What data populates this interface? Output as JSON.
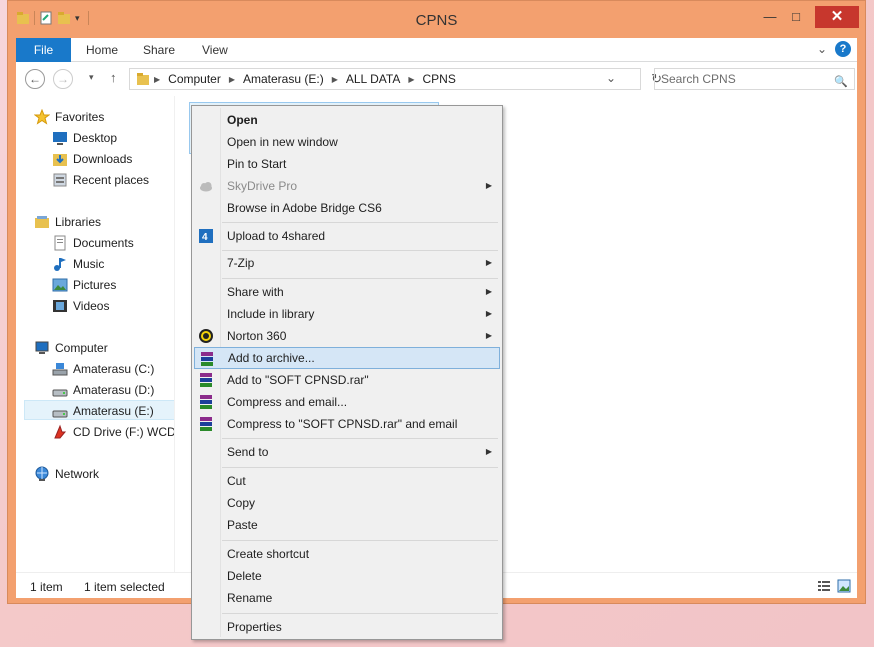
{
  "window": {
    "title": "CPNS",
    "min_label": "—",
    "max_label": "□",
    "close_label": "✕"
  },
  "ribbon": {
    "file_label": "File",
    "tabs": [
      "Home",
      "Share",
      "View"
    ],
    "expand_label": "⌄",
    "help_label": "?"
  },
  "nav": {
    "back_label": "←",
    "forward_label": "→",
    "recent_label": "▾",
    "up_label": "↑",
    "path": [
      "Computer",
      "Amaterasu (E:)",
      "ALL DATA",
      "CPNS"
    ],
    "dropdown_label": "⌄",
    "refresh_label": "↻",
    "search_placeholder": "Search CPNS",
    "search_icon": "🔍"
  },
  "sidebar": {
    "favorites": "Favorites",
    "favorites_items": [
      "Desktop",
      "Downloads",
      "Recent places"
    ],
    "libraries": "Libraries",
    "libraries_items": [
      "Documents",
      "Music",
      "Pictures",
      "Videos"
    ],
    "computer": "Computer",
    "computer_items": [
      "Amaterasu (C:)",
      "Amaterasu (D:)",
      "Amaterasu (E:)",
      "CD Drive (F:) WCDM"
    ],
    "network": "Network"
  },
  "status": {
    "count": "1 item",
    "selected": "1 item selected",
    "details_view_icon": "details-view-icon",
    "large_icons_view_icon": "large-icons-view-icon"
  },
  "context_menu": {
    "items": [
      "Open",
      "Open in new window",
      "Pin to Start",
      "SkyDrive Pro",
      "Browse in Adobe Bridge CS6",
      "Upload to 4shared",
      "7-Zip",
      "Share with",
      "Include in library",
      "Norton 360",
      "Add to archive...",
      "Add to \"SOFT CPNSD.rar\"",
      "Compress and email...",
      "Compress to \"SOFT CPNSD.rar\" and email",
      "Send to",
      "Cut",
      "Copy",
      "Paste",
      "Create shortcut",
      "Delete",
      "Rename",
      "Properties"
    ],
    "submenu_arrow": "▶",
    "highlighted": "Add to archive..."
  },
  "colors": {
    "frame": "#f3a06f",
    "accent": "#1979ca",
    "close": "#c7372d",
    "highlight": "#d5e6f6"
  }
}
